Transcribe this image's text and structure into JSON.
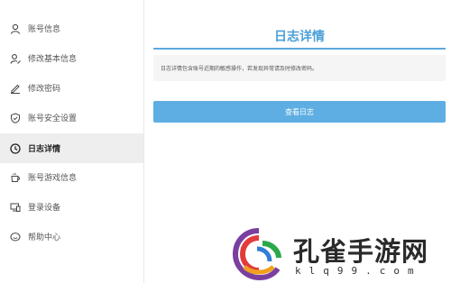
{
  "sidebar": {
    "items": [
      {
        "label": "账号信息",
        "icon": "user-icon",
        "active": false
      },
      {
        "label": "修改基本信息",
        "icon": "user-edit-icon",
        "active": false
      },
      {
        "label": "修改密码",
        "icon": "pencil-icon",
        "active": false
      },
      {
        "label": "账号安全设置",
        "icon": "shield-check-icon",
        "active": false
      },
      {
        "label": "日志详情",
        "icon": "clock-icon",
        "active": true
      },
      {
        "label": "账号游戏信息",
        "icon": "cup-icon",
        "active": false
      },
      {
        "label": "登录设备",
        "icon": "devices-icon",
        "active": false
      },
      {
        "label": "帮助中心",
        "icon": "chat-icon",
        "active": false
      }
    ]
  },
  "main": {
    "title": "日志详情",
    "notice": "日志详情包含账号近期的敏感操作，若发现异常请及时修改密码。",
    "button_label": "查看日志"
  },
  "watermark": {
    "text": "孔雀手游网",
    "url": "klq99.com"
  },
  "colors": {
    "accent": "#4a9fd8",
    "button": "#5faee3",
    "active_bg": "#eeeeee"
  }
}
